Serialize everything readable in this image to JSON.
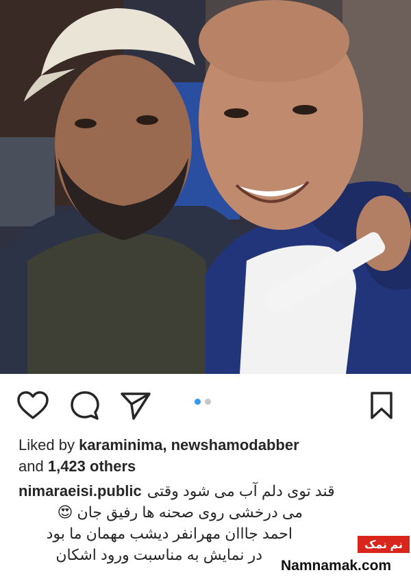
{
  "post": {
    "icons": {
      "like": "heart-icon",
      "comment": "comment-bubble-icon",
      "share": "paper-plane-icon",
      "save": "bookmark-icon"
    },
    "carousel": {
      "total": 2,
      "active": 1,
      "active_color": "#3897f0",
      "inactive_color": "#c7c7c7"
    },
    "likes": {
      "prefix": "Liked by",
      "user1": "karaminima,",
      "user2": "newshamodabber",
      "and": "and",
      "count": "1,423 others"
    },
    "caption": {
      "username": "nimaraeisi.public",
      "line1": "قند توی دلم آب می شود وقتی",
      "line2": "می درخشی روی صحنه ها رفیق جان",
      "line2_emoji": "😍",
      "line3": "احمد جااان مهرانفر دیشب مهمان ما بود",
      "line4": "در نمایش به مناسبت ورود اشکان"
    }
  },
  "watermark": {
    "badge": "نم نمک",
    "site": "Namnamak.com",
    "badge_color": "#d9261c"
  }
}
